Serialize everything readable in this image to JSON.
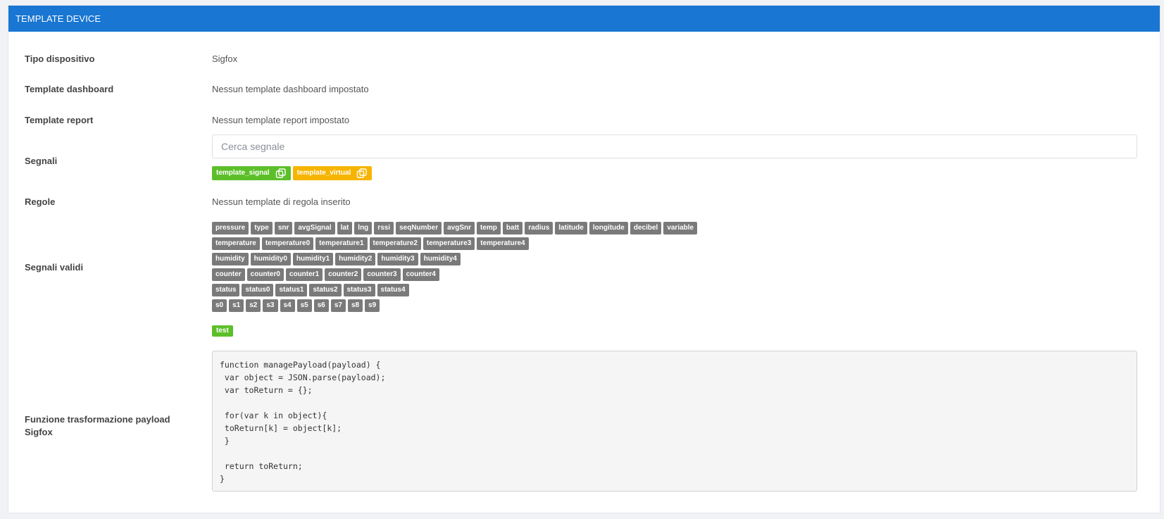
{
  "panel": {
    "title": "TEMPLATE DEVICE"
  },
  "fields": {
    "device_type": {
      "label": "Tipo dispositivo",
      "value": "Sigfox"
    },
    "dashboard": {
      "label": "Template dashboard",
      "value": "Nessun template dashboard impostato"
    },
    "report": {
      "label": "Template report",
      "value": "Nessun template report impostato"
    },
    "signals": {
      "label": "Segnali",
      "search_placeholder": "Cerca segnale",
      "chips": [
        {
          "label": "template_signal",
          "color": "#5cbf2a",
          "icon": "copy-icon"
        },
        {
          "label": "template_virtual",
          "color": "#f6b400",
          "icon": "copy-icon"
        }
      ]
    },
    "rules": {
      "label": "Regole",
      "value": "Nessun template di regola inserito"
    },
    "valid_signals": {
      "label": "Segnali validi",
      "lines": [
        [
          "pressure",
          "type",
          "snr",
          "avgSignal",
          "lat",
          "lng",
          "rssi",
          "seqNumber",
          "avgSnr",
          "temp",
          "batt",
          "radius",
          "latitude",
          "longitude",
          "decibel",
          "variable"
        ],
        [
          "temperature",
          "temperature0",
          "temperature1",
          "temperature2",
          "temperature3",
          "temperature4"
        ],
        [
          "humidity",
          "humidity0",
          "humidity1",
          "humidity2",
          "humidity3",
          "humidity4"
        ],
        [
          "counter",
          "counter0",
          "counter1",
          "counter2",
          "counter3",
          "counter4"
        ],
        [
          "status",
          "status0",
          "status1",
          "status2",
          "status3",
          "status4"
        ],
        [
          "s0",
          "s1",
          "s2",
          "s3",
          "s4",
          "s5",
          "s6",
          "s7",
          "s8",
          "s9"
        ]
      ],
      "chip_color": "#7a7a7a"
    },
    "transform": {
      "label_line1": "Funzione trasformazione payload",
      "label_line2": "Sigfox",
      "test_label": "test",
      "code": "function managePayload(payload) {\n var object = JSON.parse(payload);\n var toReturn = {};\n\n for(var k in object){\n toReturn[k] = object[k];\n }\n\n return toReturn;\n}"
    }
  },
  "colors": {
    "header": "#1976d2",
    "green": "#5cbf2a",
    "yellow": "#f6b400"
  }
}
